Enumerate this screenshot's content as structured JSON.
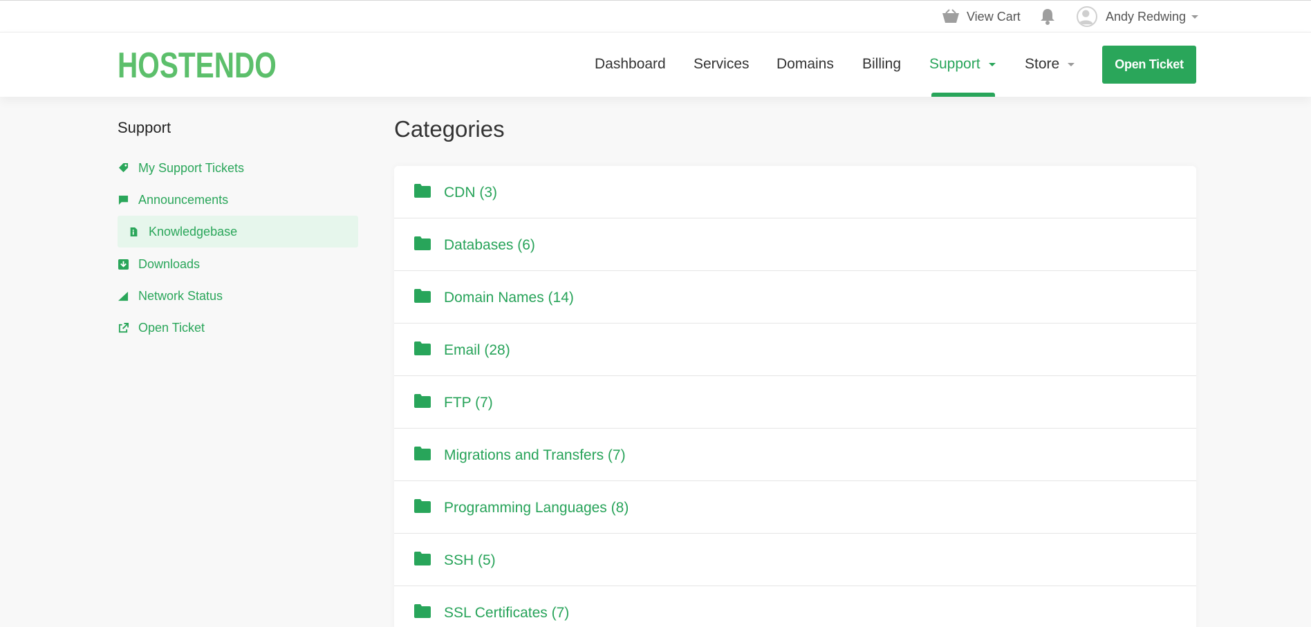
{
  "topbar": {
    "cart_label": "View Cart",
    "user_name": "Andy Redwing"
  },
  "header": {
    "logo": "HOSTENDO",
    "nav": [
      {
        "label": "Dashboard",
        "active": false,
        "dropdown": false
      },
      {
        "label": "Services",
        "active": false,
        "dropdown": false
      },
      {
        "label": "Domains",
        "active": false,
        "dropdown": false
      },
      {
        "label": "Billing",
        "active": false,
        "dropdown": false
      },
      {
        "label": "Support",
        "active": true,
        "dropdown": true
      },
      {
        "label": "Store",
        "active": false,
        "dropdown": true
      }
    ],
    "open_ticket_label": "Open Ticket"
  },
  "sidebar": {
    "title": "Support",
    "items": [
      {
        "label": "My Support Tickets",
        "icon": "ticket-icon",
        "active": false
      },
      {
        "label": "Announcements",
        "icon": "comment-icon",
        "active": false
      },
      {
        "label": "Knowledgebase",
        "icon": "file-icon",
        "active": true
      },
      {
        "label": "Downloads",
        "icon": "download-icon",
        "active": false
      },
      {
        "label": "Network Status",
        "icon": "signal-icon",
        "active": false
      },
      {
        "label": "Open Ticket",
        "icon": "external-link-icon",
        "active": false
      }
    ]
  },
  "main": {
    "title": "Categories",
    "categories": [
      {
        "label": "CDN (3)"
      },
      {
        "label": "Databases (6)"
      },
      {
        "label": "Domain Names (14)"
      },
      {
        "label": "Email (28)"
      },
      {
        "label": "FTP (7)"
      },
      {
        "label": "Migrations and Transfers (7)"
      },
      {
        "label": "Programming Languages (8)"
      },
      {
        "label": "SSH (5)"
      },
      {
        "label": "SSL Certificates (7)"
      }
    ]
  },
  "colors": {
    "brand_green": "#2aa65a",
    "logo_green": "#5cbf6b",
    "active_bg": "#e6f6ec"
  }
}
